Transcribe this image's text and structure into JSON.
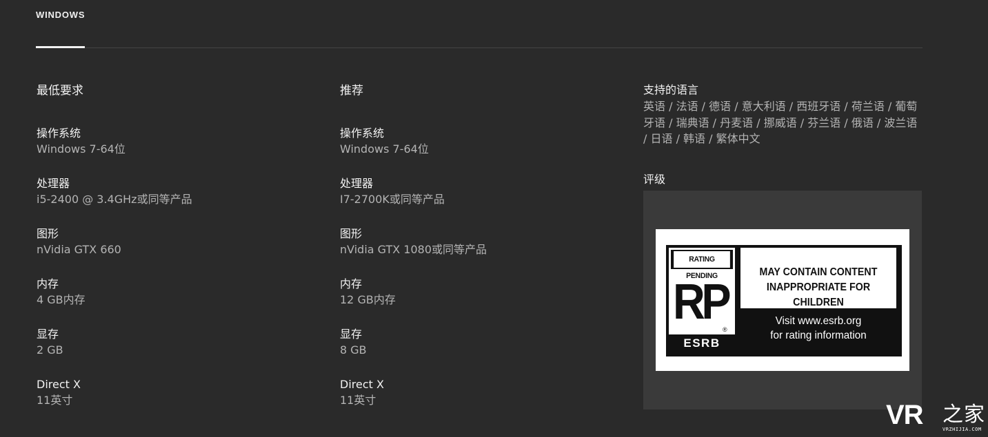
{
  "tabs": {
    "windows_label": "WINDOWS"
  },
  "minimum": {
    "title": "最低要求",
    "specs": [
      {
        "label": "操作系统",
        "value": "Windows 7-64位"
      },
      {
        "label": "处理器",
        "value": "i5-2400 @ 3.4GHz或同等产品"
      },
      {
        "label": "图形",
        "value": "nVidia GTX 660"
      },
      {
        "label": "内存",
        "value": "4 GB内存"
      },
      {
        "label": "显存",
        "value": "2 GB"
      },
      {
        "label": "Direct X",
        "value": "11英寸"
      }
    ]
  },
  "recommended": {
    "title": "推荐",
    "specs": [
      {
        "label": "操作系统",
        "value": "Windows 7-64位"
      },
      {
        "label": "处理器",
        "value": "I7-2700K或同等产品"
      },
      {
        "label": "图形",
        "value": "nVidia GTX 1080或同等产品"
      },
      {
        "label": "内存",
        "value": "12 GB内存"
      },
      {
        "label": "显存",
        "value": "8 GB"
      },
      {
        "label": "Direct X",
        "value": "11英寸"
      }
    ]
  },
  "languages": {
    "title": "支持的语言",
    "list": "英语 / 法语 / 德语 / 意大利语 / 西班牙语 / 荷兰语 / 葡萄牙语 / 瑞典语 / 丹麦语 / 挪威语 / 芬兰语 / 俄语 / 波兰语 / 日语 / 韩语 / 繁体中文"
  },
  "rating": {
    "title": "评级",
    "badge_top": "RATING PENDING",
    "badge_symbol": "RP",
    "badge_registered": "®",
    "badge_brand": "ESRB",
    "content_line1": "MAY CONTAIN CONTENT",
    "content_line2": "INAPPROPRIATE FOR CHILDREN",
    "visit_line1": "Visit www.esrb.org",
    "visit_line2": "for rating information"
  },
  "watermark": {
    "logo": "VR",
    "chinese": "之家",
    "url": "VRZHIJIA.COM"
  },
  "colors": {
    "background": "#2a2a2a",
    "panel": "#3a3a3a",
    "label": "#f2f2f2",
    "value": "#b4b4b4",
    "divider": "#444444"
  }
}
